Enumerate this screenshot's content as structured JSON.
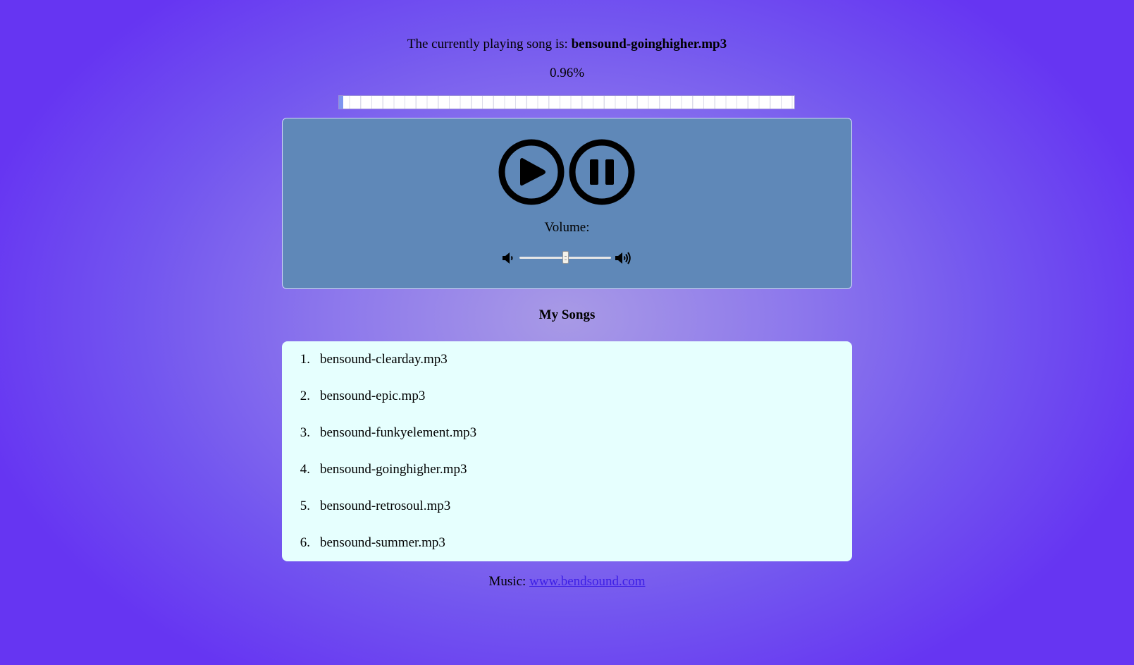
{
  "now_playing": {
    "prefix": "The currently playing song is:",
    "song": "bensound-goinghigher.mp3"
  },
  "progress": {
    "label": "0.96%",
    "value_percent": 0.96
  },
  "controls": {
    "play_icon": "play-circle-icon",
    "pause_icon": "pause-circle-icon",
    "volume_label": "Volume:",
    "volume_down_icon": "volume-down-icon",
    "volume_up_icon": "volume-up-icon",
    "volume_fraction": 0.5
  },
  "songs": {
    "title": "My Songs",
    "items": [
      {
        "num": "1.",
        "name": "bensound-clearday.mp3"
      },
      {
        "num": "2.",
        "name": "bensound-epic.mp3"
      },
      {
        "num": "3.",
        "name": "bensound-funkyelement.mp3"
      },
      {
        "num": "4.",
        "name": "bensound-goinghigher.mp3"
      },
      {
        "num": "5.",
        "name": "bensound-retrosoul.mp3"
      },
      {
        "num": "6.",
        "name": "bensound-summer.mp3"
      }
    ]
  },
  "footer": {
    "prefix": "Music:",
    "link_text": "www.bendsound.com"
  },
  "colors": {
    "background_center": "#a89ae6",
    "background_edge": "#6635f2",
    "player_panel": "#5f88b8",
    "song_list_bg": "#e6fffe",
    "link": "#3d1fe6",
    "progress_fill": "#7d95f0"
  }
}
